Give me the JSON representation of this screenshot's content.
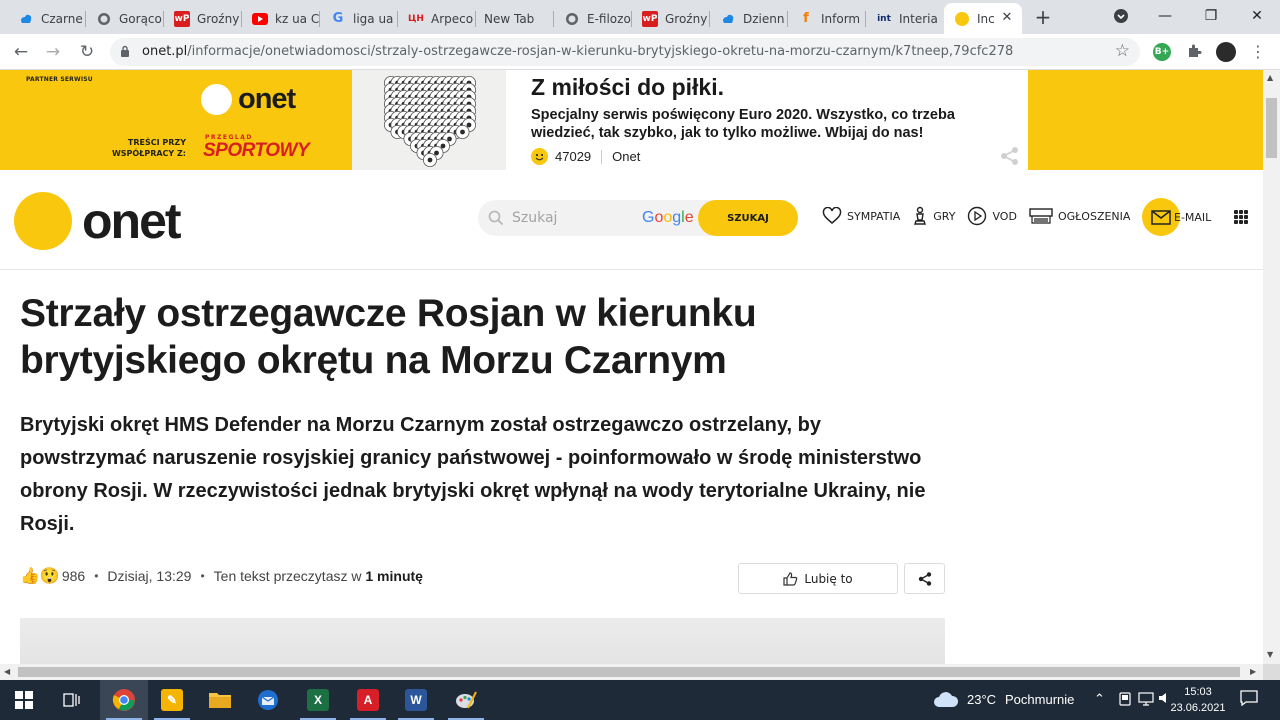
{
  "browser": {
    "tabs": [
      {
        "title": "Czarne",
        "icon": "cloud-paw-icon"
      },
      {
        "title": "Gorąco",
        "icon": "globe-icon"
      },
      {
        "title": "Groźny",
        "icon": "wp-icon"
      },
      {
        "title": "kz ua C",
        "icon": "youtube-icon"
      },
      {
        "title": "liga ua",
        "icon": "google-icon"
      },
      {
        "title": "Arpeco",
        "icon": "cn-icon"
      },
      {
        "title": "New Tab",
        "icon": "none"
      },
      {
        "title": "E-filozo",
        "icon": "globe-icon"
      },
      {
        "title": "Groźny",
        "icon": "wp-icon"
      },
      {
        "title": "Dzienn",
        "icon": "cloud-paw-icon"
      },
      {
        "title": "Inform",
        "icon": "f-icon"
      },
      {
        "title": "Interia",
        "icon": "int-icon"
      },
      {
        "title": "Inc",
        "icon": "onet-dot-icon",
        "active": true
      }
    ],
    "url_host": "onet.pl",
    "url_path": "/informacje/onetwiadomosci/strzaly-ostrzegawcze-rosjan-w-kierunku-brytyjskiego-okretu-na-morzu-czarnym/k7tneep,79cfc278",
    "extension_badge": "B+"
  },
  "banner": {
    "partner_label": "PARTNER SERWISU",
    "logo_text": "onet",
    "partnership_label": "TREŚCI PRZY WSPÓŁPRACY Z:",
    "partner_brand_top": "PRZEGLĄD",
    "partner_brand": "SPORTOWY",
    "headline": "Z miłości do piłki.",
    "description": "Specjalny serwis poświęcony Euro 2020. Wszystko, co trzeba wiedzieć, tak szybko, jak to tylko możliwe. Wbijaj do nas!",
    "reactions": "47029",
    "source": "Onet"
  },
  "header": {
    "logo_text": "onet",
    "search_placeholder": "Szukaj",
    "google_label": "Google",
    "search_button": "SZUKAJ",
    "nav": [
      {
        "label": "SYMPATIA",
        "icon": "heart-icon"
      },
      {
        "label": "GRY",
        "icon": "chess-icon"
      },
      {
        "label": "VOD",
        "icon": "play-icon"
      },
      {
        "label": "OGŁOSZENIA",
        "icon": "register-icon"
      }
    ],
    "mail_label": "E-MAIL"
  },
  "article": {
    "title": "Strzały ostrzegawcze Rosjan w kierunku brytyjskiego okrętu na Morzu Czarnym",
    "lead": "Brytyjski okręt HMS Defender na Morzu Czarnym został ostrzegawczo ostrzelany, by powstrzymać naruszenie rosyjskiej granicy państwowej - poinformowało w środę ministerstwo obrony Rosji. W rzeczywistości jednak brytyjski okręt wpłynął na wody terytorialne Ukrainy, nie Rosji.",
    "reactions_count": "986",
    "date": "Dzisiaj, 13:29",
    "read_time_prefix": "Ten tekst przeczytasz w",
    "read_time": "1 minutę",
    "like_label": "Lubię to"
  },
  "taskbar": {
    "weather_temp": "23°C",
    "weather_desc": "Pochmurnie",
    "time": "15:03",
    "date": "23.06.2021"
  },
  "colors": {
    "onet_yellow": "#f9c80e",
    "taskbar": "#1f2a38",
    "tabstrip": "#dee1e6"
  }
}
